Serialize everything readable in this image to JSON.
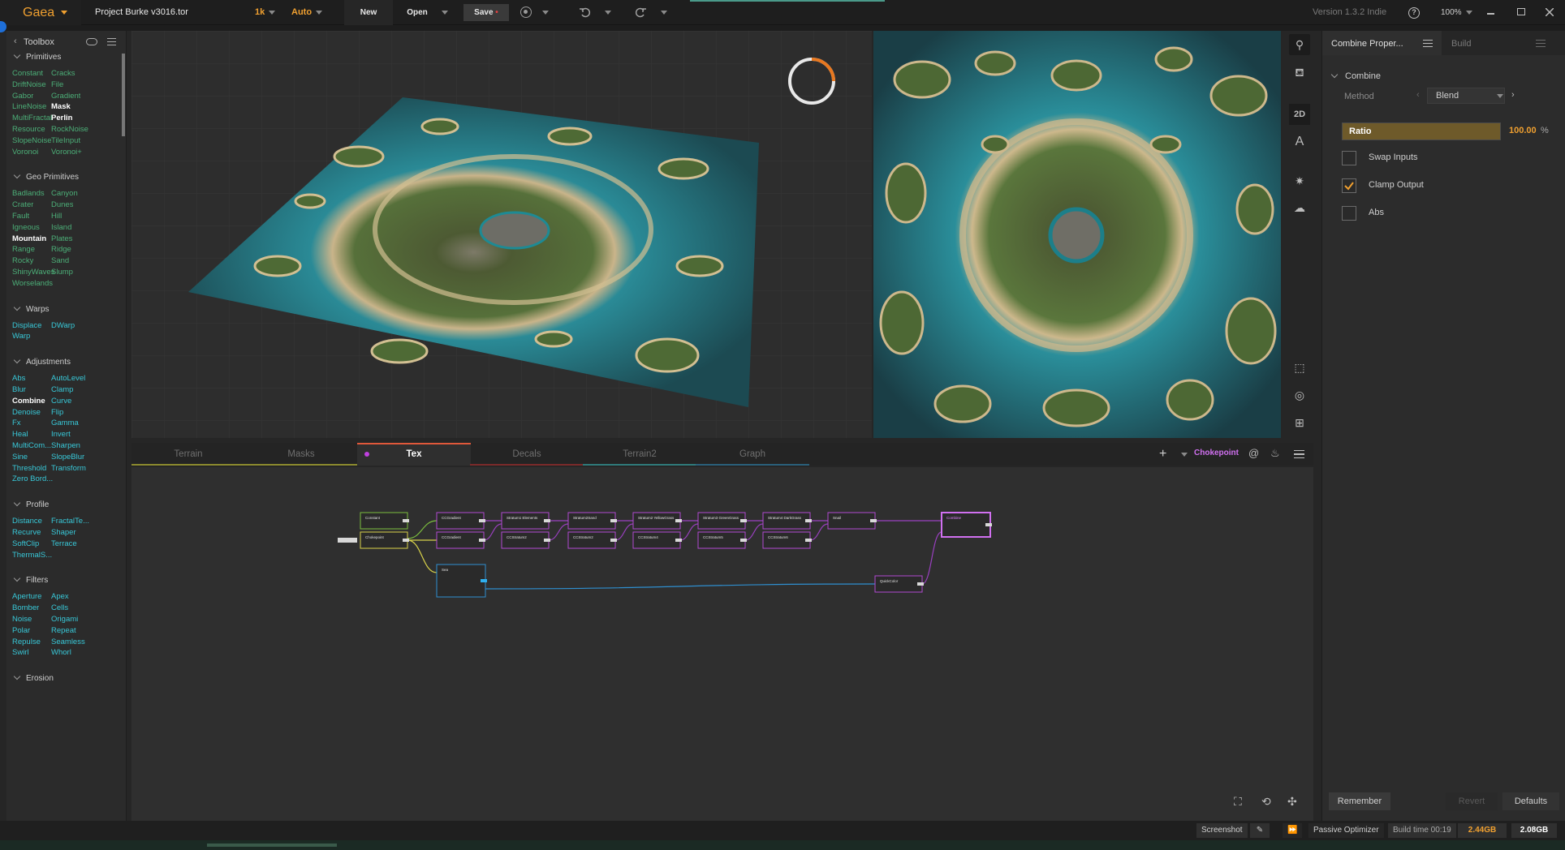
{
  "app": {
    "name": "Gaea",
    "project": "Project Burke v3016.tor",
    "resolution": "1k",
    "mode": "Auto",
    "version": "Version 1.3.2 Indie",
    "zoom": "100%"
  },
  "toolbar": {
    "new_label": "New",
    "open_label": "Open",
    "save_label": "Save"
  },
  "toolbox": {
    "title": "Toolbox",
    "sections": [
      {
        "title": "Primitives",
        "items": [
          [
            "Constant",
            "Cracks"
          ],
          [
            "DriftNoise",
            "File"
          ],
          [
            "Gabor",
            "Gradient"
          ],
          [
            "LineNoise",
            "Mask"
          ],
          [
            "MultiFractal",
            "Perlin"
          ],
          [
            "Resource",
            "RockNoise"
          ],
          [
            "SlopeNoise",
            "TileInput"
          ],
          [
            "Voronoi",
            "Voronoi+"
          ]
        ]
      },
      {
        "title": "Geo Primitives",
        "items": [
          [
            "Badlands",
            "Canyon"
          ],
          [
            "Crater",
            "Dunes"
          ],
          [
            "Fault",
            "Hill"
          ],
          [
            "Igneous",
            "Island"
          ],
          [
            "Mountain",
            "Plates"
          ],
          [
            "Range",
            "Ridge"
          ],
          [
            "Rocky",
            "Sand"
          ],
          [
            "ShinyWaves",
            "Slump"
          ],
          [
            "Worselands",
            ""
          ]
        ]
      },
      {
        "title": "Warps",
        "items": [
          [
            "Displace",
            "DWarp"
          ],
          [
            "Warp",
            ""
          ]
        ]
      },
      {
        "title": "Adjustments",
        "items": [
          [
            "Abs",
            "AutoLevel"
          ],
          [
            "Blur",
            "Clamp"
          ],
          [
            "Combine",
            "Curve"
          ],
          [
            "Denoise",
            "Flip"
          ],
          [
            "Fx",
            "Gamma"
          ],
          [
            "Heal",
            "Invert"
          ],
          [
            "MultiCom...",
            "Sharpen"
          ],
          [
            "Sine",
            "SlopeBlur"
          ],
          [
            "Threshold",
            "Transform"
          ],
          [
            "Zero Bord...",
            ""
          ]
        ]
      },
      {
        "title": "Profile",
        "items": [
          [
            "Distance",
            "FractalTe..."
          ],
          [
            "Recurve",
            "Shaper"
          ],
          [
            "SoftClip",
            "Terrace"
          ],
          [
            "ThermalS...",
            ""
          ]
        ]
      },
      {
        "title": "Filters",
        "items": [
          [
            "Aperture",
            "Apex"
          ],
          [
            "Bomber",
            "Cells"
          ],
          [
            "Noise",
            "Origami"
          ],
          [
            "Polar",
            "Repeat"
          ],
          [
            "Repulse",
            "Seamless"
          ],
          [
            "Swirl",
            "Whorl"
          ]
        ]
      },
      {
        "title": "Erosion",
        "items": []
      }
    ]
  },
  "viewport": {
    "mode_2d": "2D"
  },
  "graph_tabs": [
    "Terrain",
    "Masks",
    "Tex",
    "Decals",
    "Terrain2",
    "Graph"
  ],
  "graph_tab_colors": [
    "#8b8a2e",
    "#8b8a2e",
    "#e0583a",
    "#7a2a2a",
    "#2f7a7a",
    "#2a5f7a"
  ],
  "graph_toolbar": {
    "bookmark": "Chokepoint"
  },
  "nodes": [
    {
      "label": "Constant",
      "color": "#7bbd3e"
    },
    {
      "label": "Chokepoint",
      "color": "#d8d24a"
    },
    {
      "label": "CCGradient",
      "color": "#b04ad0"
    },
    {
      "label": "CCGradient",
      "color": "#b04ad0"
    },
    {
      "label": "Stratum1 Elements",
      "color": "#b04ad0"
    },
    {
      "label": "CCStratum2",
      "color": "#b04ad0"
    },
    {
      "label": "Stratum2Sand",
      "color": "#b04ad0"
    },
    {
      "label": "CCStratum2",
      "color": "#b04ad0"
    },
    {
      "label": "Stratum2 YellowGrass",
      "color": "#b04ad0"
    },
    {
      "label": "CCStratum4",
      "color": "#b04ad0"
    },
    {
      "label": "Stratum3 GreenGrass",
      "color": "#b04ad0"
    },
    {
      "label": "CCStratum5",
      "color": "#b04ad0"
    },
    {
      "label": "Stratum4 DarkGrass",
      "color": "#b04ad0"
    },
    {
      "label": "CCStratum6",
      "color": "#b04ad0"
    },
    {
      "label": "Snail",
      "color": "#b04ad0"
    },
    {
      "label": "Combine",
      "color": "#d070f0"
    },
    {
      "label": "Sea",
      "color": "#2f8fd0"
    },
    {
      "label": "QuickColor",
      "color": "#b04ad0"
    }
  ],
  "properties": {
    "title": "Combine Proper...",
    "build_tab": "Build",
    "group": "Combine",
    "method_label": "Method",
    "method_value": "Blend",
    "ratio_label": "Ratio",
    "ratio_value": "100.00",
    "ratio_unit": "%",
    "ratio_fraction": 1.0,
    "checkboxes": [
      {
        "label": "Swap Inputs",
        "checked": false
      },
      {
        "label": "Clamp Output",
        "checked": true
      },
      {
        "label": "Abs",
        "checked": false
      }
    ],
    "remember": "Remember",
    "revert": "Revert",
    "defaults": "Defaults"
  },
  "status": {
    "screenshot": "Screenshot",
    "optimizer": "Passive Optimizer",
    "build_time": "Build time 00:19",
    "mem1": "2.44GB",
    "mem2": "2.08GB"
  },
  "colors": {
    "accent": "#f0a030",
    "green_item": "#4caf78",
    "cyan_item": "#38c8d8",
    "selected_node": "#d070f0"
  }
}
